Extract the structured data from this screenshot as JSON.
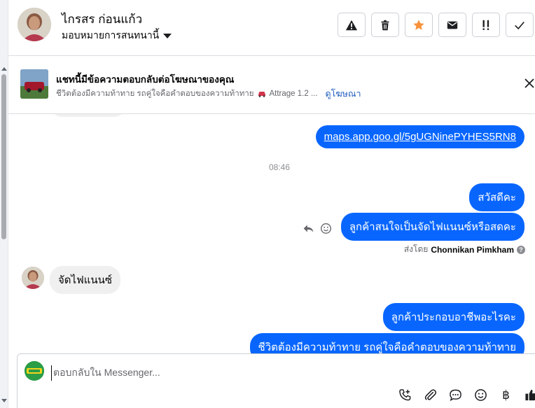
{
  "header": {
    "contact_name": "ไกรสร ก่อนแก้ว",
    "assign_label": "มอบหมายการสนทนานี้",
    "actions": [
      {
        "name": "warning-icon"
      },
      {
        "name": "trash-icon"
      },
      {
        "name": "star-icon",
        "color": "#f7923b"
      },
      {
        "name": "envelope-icon"
      },
      {
        "name": "priority-icon"
      },
      {
        "name": "check-icon"
      }
    ]
  },
  "banner": {
    "title": "แชทนี้มีข้อความตอบกลับต่อโฆษณาของคุณ",
    "subtitle": "ชีวิตต้องมีความท้าทาย รถคู่ใจคือคำตอบของความท้าทาย",
    "subtitle_suffix": "Attrage 1.2 ...",
    "link": "ดูโฆษณา"
  },
  "messages": {
    "link_message": "maps.app.goo.gl/5gUGNinePYHES5RN8",
    "time": "08:46",
    "out_greeting": "สวัสดีคะ",
    "out_question": "ลูกค้าสนใจเป็นจัดไฟแนนซ์หรือสดคะ",
    "sent_by_prefix": "ส่งโดย",
    "sent_by_name": "Chonnikan Pimkham",
    "in_reply": "จัดไฟแนนซ์",
    "out_occupation": "ลูกค้าประกอบอาชีพอะไรคะ",
    "out_partial": "ชีวิตต้องมีความท้าทาย รถคู่ใจคือคำตอบของความท้าทาย"
  },
  "composer": {
    "placeholder": "ตอบกลับใน Messenger...",
    "tools": [
      "phone-plus-icon",
      "paperclip-icon",
      "chat-bubble-icon",
      "emoji-icon",
      "baht-icon",
      "thumbs-up-icon"
    ],
    "baht_symbol": "฿"
  },
  "colors": {
    "accent_blue": "#0866ff",
    "incoming_gray": "#f0f0f0",
    "star_orange": "#f7923b"
  }
}
